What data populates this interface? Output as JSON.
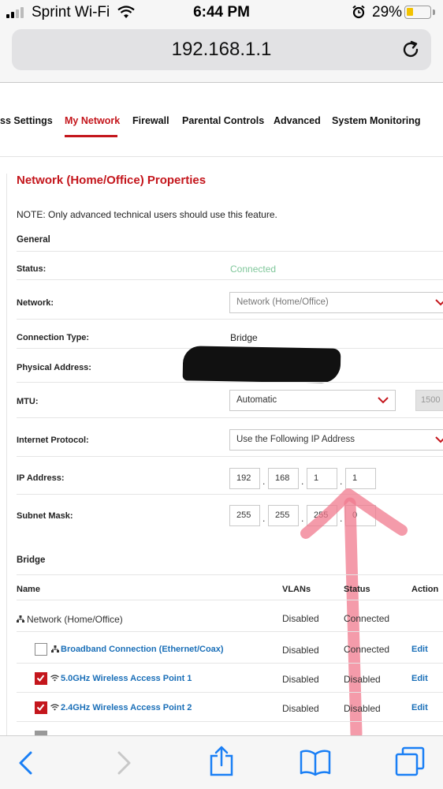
{
  "status_bar": {
    "carrier": "Sprint Wi-Fi",
    "time": "6:44 PM",
    "battery": "29%",
    "battery_level": 0.29
  },
  "browser": {
    "url": "192.168.1.1"
  },
  "nav_tabs": [
    {
      "label": "ss Settings"
    },
    {
      "label": "My Network"
    },
    {
      "label": "Firewall"
    },
    {
      "label": "Parental Controls"
    },
    {
      "label": "Advanced"
    },
    {
      "label": "System Monitoring"
    }
  ],
  "page": {
    "title": "Network (Home/Office) Properties",
    "note": "NOTE: Only advanced technical users should use this feature.",
    "general_section": "General",
    "status_label": "Status:",
    "status_value": "Connected",
    "network_label": "Network:",
    "network_value": "Network (Home/Office)",
    "connection_type_label": "Connection Type:",
    "connection_type_value": "Bridge",
    "physical_address_label": "Physical Address:",
    "mtu_label": "MTU:",
    "mtu_value": "Automatic",
    "mtu_size": "1500",
    "internet_protocol_label": "Internet Protocol:",
    "internet_protocol_value": "Use the Following IP Address",
    "ip_address_label": "IP Address:",
    "ip_address": [
      "192",
      "168",
      "1",
      "1"
    ],
    "subnet_mask_label": "Subnet Mask:",
    "subnet_mask": [
      "255",
      "255",
      "255",
      "0"
    ],
    "bridge_section": "Bridge"
  },
  "bridge_table": {
    "headers": {
      "name": "Name",
      "vlans": "VLANs",
      "status": "Status",
      "action": "Action"
    },
    "rows": [
      {
        "name": "Network (Home/Office)",
        "vlans": "Disabled",
        "status": "Connected",
        "action": ""
      },
      {
        "name": "Broadband Connection (Ethernet/Coax)",
        "vlans": "Disabled",
        "status": "Connected",
        "action": "Edit"
      },
      {
        "name": "5.0GHz Wireless Access Point 1",
        "vlans": "Disabled",
        "status": "Disabled",
        "action": "Edit"
      },
      {
        "name": "2.4GHz Wireless Access Point 2",
        "vlans": "Disabled",
        "status": "Disabled",
        "action": "Edit"
      }
    ]
  },
  "colors": {
    "accent_red": "#c4161c",
    "link_blue": "#1a6fb8",
    "connected_green": "#7fc79a",
    "ios_blue": "#1a7ff5"
  }
}
